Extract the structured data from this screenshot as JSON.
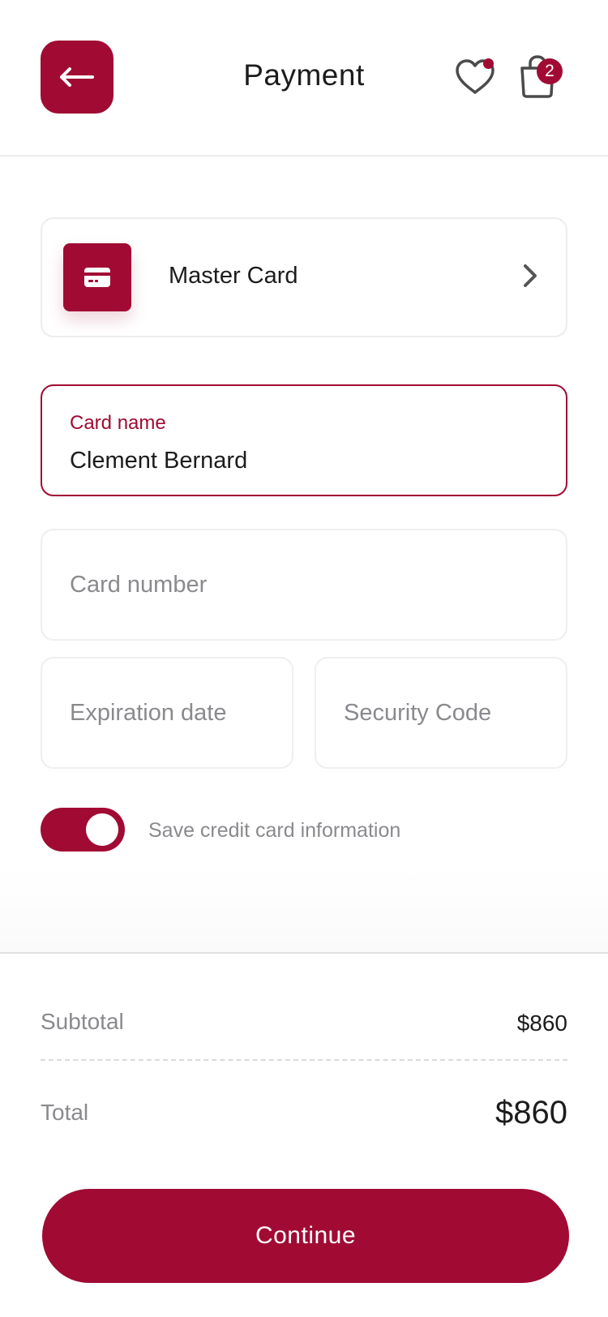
{
  "header": {
    "title": "Payment",
    "back_icon": "arrow-left-icon",
    "wishlist_icon": "heart-icon",
    "cart_icon": "shopping-bag-icon",
    "cart_count": "2"
  },
  "payment_method": {
    "label": "Master Card",
    "icon": "credit-card-icon"
  },
  "form": {
    "card_name": {
      "label": "Card name",
      "value": "Clement Bernard"
    },
    "card_number": {
      "placeholder": "Card number"
    },
    "expiration": {
      "placeholder": "Expiration date"
    },
    "security_code": {
      "placeholder": "Security Code"
    },
    "save_card": {
      "label": "Save credit card information",
      "enabled": true
    }
  },
  "summary": {
    "subtotal_label": "Subtotal",
    "subtotal_value": "$860",
    "total_label": "Total",
    "total_value": "$860"
  },
  "actions": {
    "continue_label": "Continue"
  },
  "colors": {
    "accent": "#a10b33",
    "muted_text": "#8a8a8e",
    "border": "#ededed"
  }
}
